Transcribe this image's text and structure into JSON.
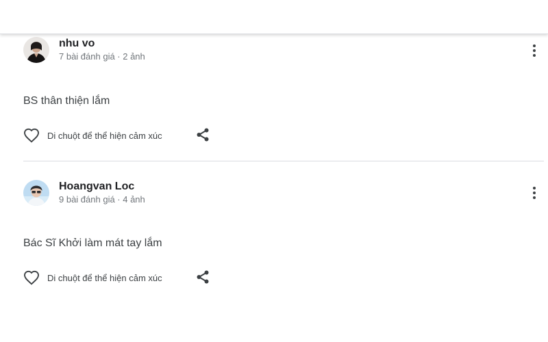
{
  "reviews": [
    {
      "author": "nhu vo",
      "meta": "7 bài đánh giá · 2 ảnh",
      "text": "BS thân thiện lắm",
      "like_label": "Di chuột để thể hiện cảm xúc",
      "avatar_icon": "person-avatar-dark",
      "more_icon": "more-vertical-icon",
      "like_icon": "heart-outline-icon",
      "share_icon": "share-icon"
    },
    {
      "author": "Hoangvan Loc",
      "meta": "9 bài đánh giá · 4 ảnh",
      "text": "Bác Sĩ Khởi làm mát tay lắm",
      "like_label": "Di chuột để thể hiện cảm xúc",
      "avatar_icon": "person-avatar-light",
      "more_icon": "more-vertical-icon",
      "like_icon": "heart-outline-icon",
      "share_icon": "share-icon"
    }
  ],
  "colors": {
    "name": "#202124",
    "meta": "#70757a",
    "text": "#3c4043",
    "divider": "#dadce0",
    "icon": "#3c4043"
  }
}
